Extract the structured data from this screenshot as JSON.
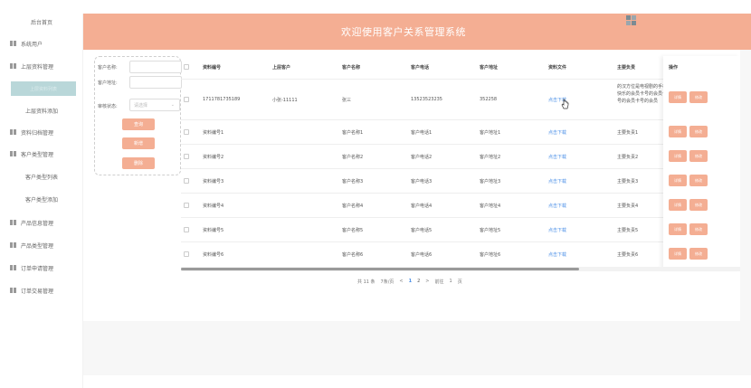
{
  "header": {
    "title": "欢迎使用客户关系管理系统"
  },
  "sidebar": {
    "items": [
      {
        "label": "后台首页"
      },
      {
        "label": "系统用户"
      },
      {
        "label": "上层资料管理"
      },
      {
        "label": "上层资料列表"
      },
      {
        "label": "上层资料添加"
      },
      {
        "label": "资料归档管理"
      },
      {
        "label": "客户类型管理"
      },
      {
        "label": "客户类型列表"
      },
      {
        "label": "客户类型添加"
      },
      {
        "label": "产品信息管理"
      },
      {
        "label": "产品类型管理"
      },
      {
        "label": "订单申请管理"
      },
      {
        "label": "订单交易管理"
      }
    ]
  },
  "search": {
    "name_label": "客户名称:",
    "address_label": "客户地址:",
    "status_label": "审核状态:",
    "status_placeholder": "请选择",
    "btn_search": "查询",
    "btn_add": "新增",
    "btn_delete": "删除"
  },
  "table": {
    "headers": [
      "资料编号",
      "上层客户",
      "客户名称",
      "客户电话",
      "客户地址",
      "资料文件",
      "主要负责",
      "操作"
    ],
    "rows": [
      {
        "code": "1711781735189",
        "upper": "小张-11111",
        "name": "张三",
        "phone": "13523523235",
        "addr": "352258",
        "file": "点击下载",
        "resp": "的汉方位是电视剧的手机快乐的会员卡号的会员卡号的会员卡号的会员"
      },
      {
        "code": "资料编号1",
        "upper": "",
        "name": "客户名称1",
        "phone": "客户电话1",
        "addr": "客户地址1",
        "file": "点击下载",
        "resp": "主要负责1"
      },
      {
        "code": "资料编号2",
        "upper": "",
        "name": "客户名称2",
        "phone": "客户电话2",
        "addr": "客户地址2",
        "file": "点击下载",
        "resp": "主要负责2"
      },
      {
        "code": "资料编号3",
        "upper": "",
        "name": "客户名称3",
        "phone": "客户电话3",
        "addr": "客户地址3",
        "file": "点击下载",
        "resp": "主要负责3"
      },
      {
        "code": "资料编号4",
        "upper": "",
        "name": "客户名称4",
        "phone": "客户电话4",
        "addr": "客户地址4",
        "file": "点击下载",
        "resp": "主要负责4"
      },
      {
        "code": "资料编号5",
        "upper": "",
        "name": "客户名称5",
        "phone": "客户电话5",
        "addr": "客户地址5",
        "file": "点击下载",
        "resp": "主要负责5"
      },
      {
        "code": "资料编号6",
        "upper": "",
        "name": "客户名称6",
        "phone": "客户电话6",
        "addr": "客户地址6",
        "file": "点击下载",
        "resp": "主要负责6"
      }
    ],
    "detail_label": "详情",
    "edit_label": "修改"
  },
  "pagination": {
    "total": "共 11 条",
    "page_size": "7条/页",
    "prev": "<",
    "pages": [
      "1",
      "2"
    ],
    "next": ">",
    "goto_label": "前往",
    "goto_value": "1",
    "page_suffix": "页"
  },
  "colors": {
    "accent": "#f4ae93",
    "link": "#4a8fe7",
    "active_menu": "#b9d7d9"
  }
}
